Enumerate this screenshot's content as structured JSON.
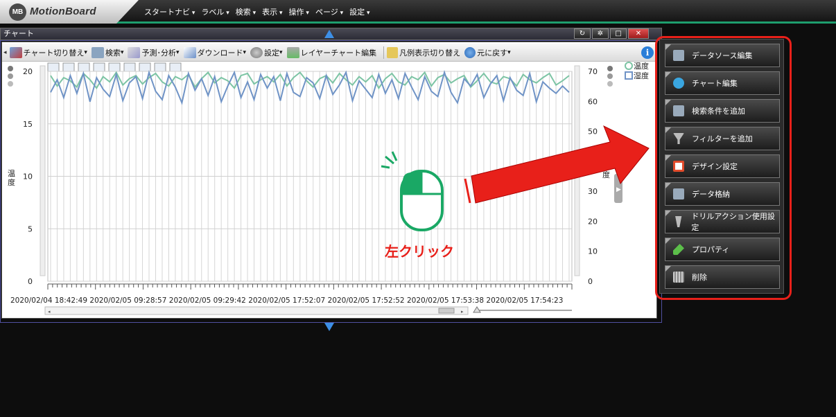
{
  "brand": {
    "badge": "MB",
    "name": "MotionBoard"
  },
  "menu": [
    "スタートナビ",
    "ラベル",
    "検索",
    "表示",
    "操作",
    "ページ",
    "設定"
  ],
  "window": {
    "title": "チャート"
  },
  "toolbar": {
    "chart_switch": "チャート切り替え",
    "search": "検索",
    "forecast": "予測･分析",
    "download": "ダウンロード",
    "settings": "設定",
    "layer_edit": "レイヤーチャート編集",
    "legend_toggle": "凡例表示切り替え",
    "undo": "元に戻す"
  },
  "chart_data": {
    "type": "line",
    "y_left": {
      "label": "温度",
      "ticks": [
        "0",
        "5",
        "10",
        "15",
        "20"
      ],
      "range": [
        0,
        20
      ]
    },
    "y_right": {
      "label": "度",
      "ticks": [
        "0",
        "10",
        "20",
        "30",
        "40",
        "50",
        "60",
        "70"
      ],
      "range": [
        0,
        70
      ]
    },
    "legend": [
      {
        "name": "温度",
        "color": "#7cc4a4",
        "marker": "circle"
      },
      {
        "name": "湿度",
        "color": "#6f93c6",
        "marker": "square"
      }
    ],
    "x_ticks": [
      "2020/02/04 18:42:49",
      "2020/02/05 09:28:57",
      "2020/02/05 09:29:42",
      "2020/02/05 17:52:07",
      "2020/02/05 17:52:52",
      "2020/02/05 17:53:38",
      "2020/02/05 17:54:23"
    ],
    "series": [
      {
        "name": "温度",
        "values": [
          19.6,
          18.6,
          19.4,
          19.1,
          18.5,
          19.8,
          19.2,
          18.4,
          19.5,
          19.0,
          19.9,
          18.7,
          19.3,
          19.6,
          18.8,
          19.4,
          19.8,
          19.0,
          18.6,
          19.5,
          19.2,
          19.7,
          18.5,
          19.3,
          19.9,
          18.9,
          19.4,
          19.1,
          18.4,
          19.6,
          19.8,
          18.8,
          19.2,
          19.5,
          19.0,
          19.7,
          18.6,
          19.4,
          19.9,
          19.1,
          18.5,
          19.3,
          19.6,
          18.9,
          19.8,
          19.2,
          18.7,
          19.5,
          19.0,
          19.6,
          18.4,
          19.3,
          19.8,
          19.0,
          18.7,
          19.5,
          19.2,
          19.9,
          18.6,
          19.4,
          19.7,
          18.9,
          19.3,
          19.6,
          18.5,
          19.1,
          19.8,
          19.0,
          18.8,
          19.5,
          19.3,
          18.6,
          19.7,
          19.2,
          18.9,
          19.4,
          19.8,
          18.7,
          19.1,
          19.6
        ]
      },
      {
        "name": "湿度",
        "values": [
          18.0,
          19.2,
          17.5,
          19.6,
          17.9,
          19.8,
          17.1,
          19.4,
          18.3,
          17.6,
          19.7,
          17.2,
          18.9,
          19.5,
          17.4,
          19.9,
          18.1,
          17.3,
          19.6,
          18.5,
          17.0,
          19.8,
          18.2,
          19.3,
          17.7,
          19.5,
          17.1,
          18.6,
          19.9,
          17.5,
          19.0,
          17.3,
          19.7,
          18.4,
          19.5,
          17.2,
          19.8,
          18.0,
          17.6,
          19.4,
          18.9,
          17.4,
          19.6,
          17.8,
          18.7,
          19.9,
          17.2,
          19.1,
          18.3,
          17.5,
          19.7,
          17.9,
          19.2,
          17.4,
          19.8,
          18.5,
          17.3,
          19.5,
          18.1,
          17.6,
          19.9,
          18.0,
          17.0,
          19.3,
          18.6,
          19.7,
          17.5,
          18.8,
          19.6,
          17.2,
          19.4,
          18.2,
          17.7,
          19.8,
          17.1,
          19.0,
          18.4,
          17.9,
          18.6,
          18.0
        ]
      }
    ]
  },
  "annotation": {
    "click_label": "左クリック"
  },
  "context_menu": [
    {
      "label": "データソース編集",
      "icon": "datasource-icon",
      "color": "#9ab"
    },
    {
      "label": "チャート編集",
      "icon": "chart-edit-icon",
      "color": "#3aa6e0"
    },
    {
      "label": "検索条件を追加",
      "icon": "search-condition-icon",
      "color": "#9ab"
    },
    {
      "label": "フィルターを追加",
      "icon": "filter-icon",
      "color": "#bbb"
    },
    {
      "label": "デザイン設定",
      "icon": "design-icon",
      "color": "#e24b2b"
    },
    {
      "label": "データ格納",
      "icon": "data-store-icon",
      "color": "#9ab"
    },
    {
      "label": "ドリルアクション使用設定",
      "icon": "drill-icon",
      "color": "#bbb"
    },
    {
      "label": "プロパティ",
      "icon": "property-icon",
      "color": "#5cbf4a"
    },
    {
      "label": "削除",
      "icon": "trash-icon",
      "color": "#aaa"
    }
  ],
  "colors": {
    "accent_green": "#1e9e6e",
    "highlight_red": "#e8201a",
    "mouse_green": "#1aa865",
    "title_blue": "#3d8fe6"
  }
}
